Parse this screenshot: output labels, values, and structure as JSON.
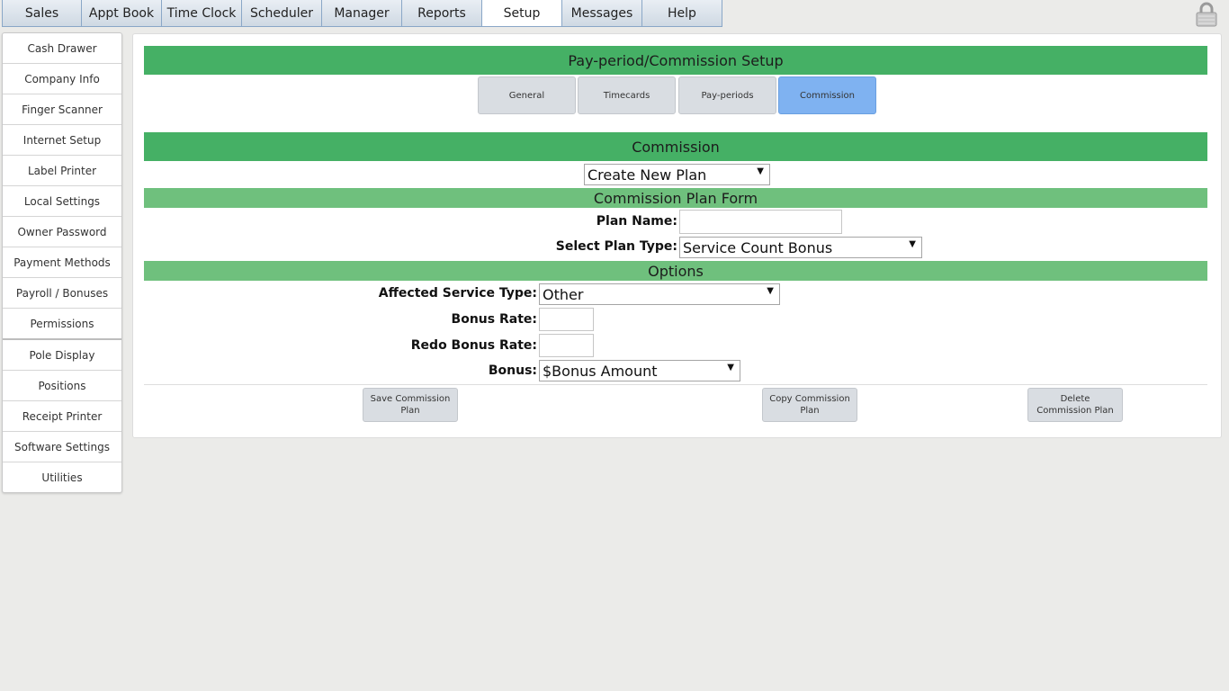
{
  "topnav": {
    "tabs": [
      {
        "label": "Sales"
      },
      {
        "label": "Appt Book"
      },
      {
        "label": "Time Clock"
      },
      {
        "label": "Scheduler"
      },
      {
        "label": "Manager"
      },
      {
        "label": "Reports"
      },
      {
        "label": "Setup",
        "active": true
      },
      {
        "label": "Messages"
      },
      {
        "label": "Help"
      }
    ]
  },
  "sidebar": {
    "items": [
      {
        "label": "Cash Drawer"
      },
      {
        "label": "Company Info"
      },
      {
        "label": "Finger Scanner"
      },
      {
        "label": "Internet Setup"
      },
      {
        "label": "Label Printer"
      },
      {
        "label": "Local Settings"
      },
      {
        "label": "Owner Password"
      },
      {
        "label": "Payment Methods"
      },
      {
        "label": "Payroll / Bonuses"
      },
      {
        "label": "Permissions"
      },
      {
        "label": "Pole Display"
      },
      {
        "label": "Positions"
      },
      {
        "label": "Receipt Printer"
      },
      {
        "label": "Software Settings"
      },
      {
        "label": "Utilities"
      }
    ]
  },
  "main": {
    "title": "Pay-period/Commission Setup",
    "subtabs": [
      {
        "label": "General"
      },
      {
        "label": "Timecards"
      },
      {
        "label": "Pay-periods"
      },
      {
        "label": "Commission",
        "active": true
      }
    ],
    "section_title": "Commission",
    "plan_select": {
      "value": "Create New Plan"
    },
    "form_title": "Commission Plan Form",
    "plan_name": {
      "label": "Plan Name:",
      "value": ""
    },
    "plan_type": {
      "label": "Select Plan Type:",
      "value": "Service Count Bonus"
    },
    "options_title": "Options",
    "affected_service_type": {
      "label": "Affected Service Type:",
      "value": "Other"
    },
    "bonus_rate": {
      "label": "Bonus Rate:",
      "value": ""
    },
    "redo_bonus_rate": {
      "label": "Redo Bonus Rate:",
      "value": ""
    },
    "bonus": {
      "label": "Bonus:",
      "value": "$Bonus Amount"
    },
    "buttons": {
      "save": "Save Commission Plan",
      "copy": "Copy Commission Plan",
      "delete": "Delete Commission Plan"
    }
  },
  "colors": {
    "header_green": "#45b065",
    "light_green": "#6fc07d",
    "active_tab_blue": "#7fb2f1"
  }
}
